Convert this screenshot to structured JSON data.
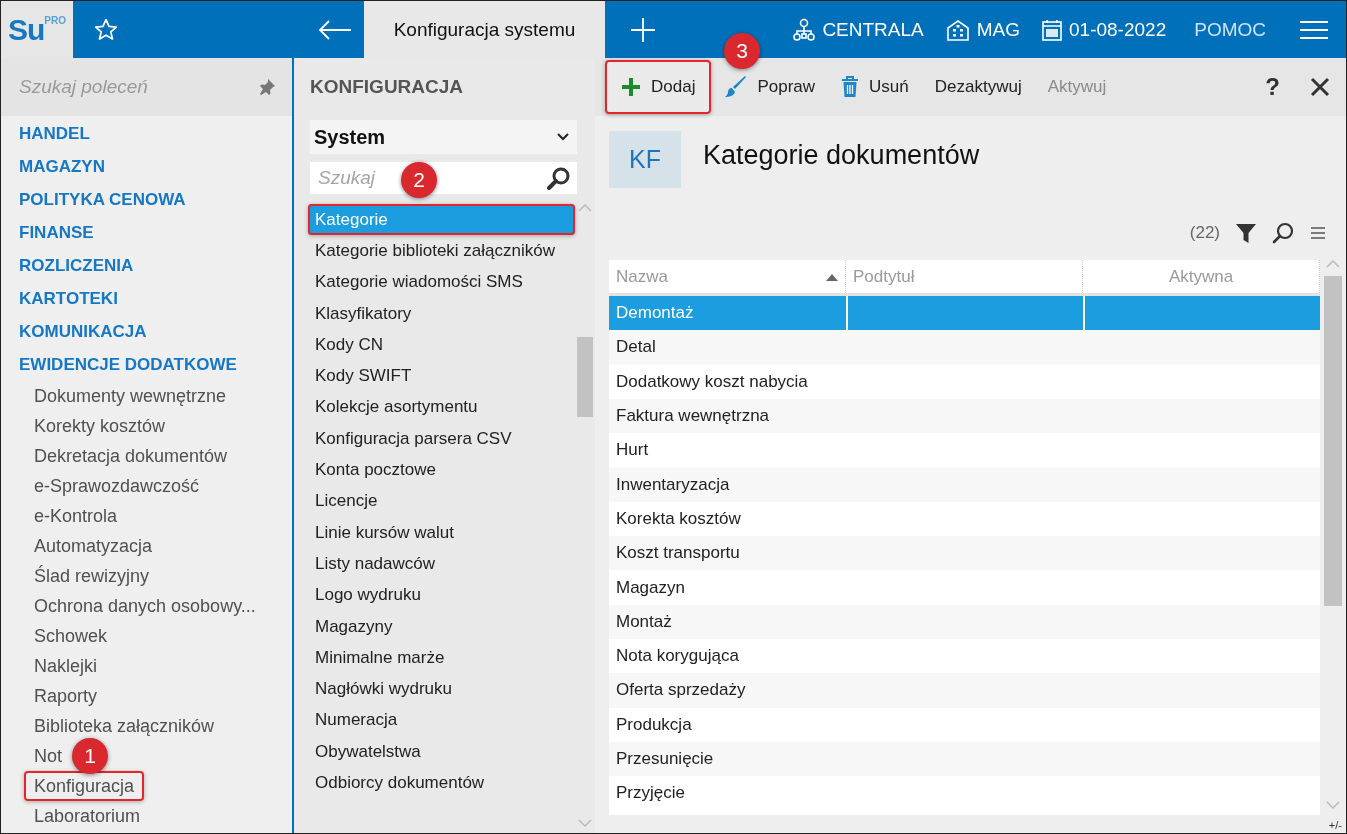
{
  "topbar": {
    "logo": "Su",
    "logo_sup": "PRO",
    "tab": "Konfiguracja systemu",
    "branch": "CENTRALA",
    "warehouse": "MAG",
    "date": "01-08-2022",
    "help": "POMOC"
  },
  "sidebar": {
    "search_placeholder": "Szukaj poleceń",
    "sections": [
      {
        "label": "HANDEL"
      },
      {
        "label": "MAGAZYN"
      },
      {
        "label": "POLITYKA CENOWA"
      },
      {
        "label": "FINANSE"
      },
      {
        "label": "ROZLICZENIA"
      },
      {
        "label": "KARTOTEKI"
      },
      {
        "label": "KOMUNIKACJA"
      },
      {
        "label": "EWIDENCJE DODATKOWE",
        "children": [
          {
            "label": "Dokumenty wewnętrzne"
          },
          {
            "label": "Korekty kosztów"
          },
          {
            "label": "Dekretacja dokumentów"
          },
          {
            "label": "e-Sprawozdawczość"
          },
          {
            "label": "e-Kontrola"
          },
          {
            "label": "Automatyzacja"
          },
          {
            "label": "Ślad rewizyjny"
          },
          {
            "label": "Ochrona danych osobowy..."
          },
          {
            "label": "Schowek"
          },
          {
            "label": "Naklejki"
          },
          {
            "label": "Raporty"
          },
          {
            "label": "Biblioteka załączników"
          },
          {
            "label": "Not"
          },
          {
            "label": "Konfiguracja",
            "callout": "1"
          },
          {
            "label": "Laboratorium"
          }
        ]
      }
    ]
  },
  "config": {
    "title": "KONFIGURACJA",
    "dropdown": "System",
    "search_placeholder": "Szukaj",
    "items": [
      {
        "label": "Kategorie",
        "selected": true,
        "callout": "2"
      },
      {
        "label": "Kategorie biblioteki załączników",
        "selected": false
      },
      {
        "label": "Kategorie wiadomości SMS",
        "selected": false
      },
      {
        "label": "Klasyfikatory",
        "selected": false
      },
      {
        "label": "Kody CN",
        "selected": false
      },
      {
        "label": "Kody SWIFT",
        "selected": false
      },
      {
        "label": "Kolekcje asortymentu",
        "selected": false
      },
      {
        "label": "Konfiguracja parsera CSV",
        "selected": false
      },
      {
        "label": "Konta pocztowe",
        "selected": false
      },
      {
        "label": "Licencje",
        "selected": false
      },
      {
        "label": "Linie kursów walut",
        "selected": false
      },
      {
        "label": "Listy nadawców",
        "selected": false
      },
      {
        "label": "Logo wydruku",
        "selected": false
      },
      {
        "label": "Magazyny",
        "selected": false
      },
      {
        "label": "Minimalne marże",
        "selected": false
      },
      {
        "label": "Nagłówki wydruku",
        "selected": false
      },
      {
        "label": "Numeracja",
        "selected": false
      },
      {
        "label": "Obywatelstwa",
        "selected": false
      },
      {
        "label": "Odbiorcy dokumentów",
        "selected": false
      }
    ]
  },
  "toolbar": {
    "actions": [
      {
        "label": "Dodaj",
        "kind": "add",
        "disabled": false,
        "callout": "3"
      },
      {
        "label": "Popraw",
        "kind": "edit",
        "disabled": false
      },
      {
        "label": "Usuń",
        "kind": "delete",
        "disabled": false
      },
      {
        "label": "Dezaktywuj",
        "kind": "text",
        "disabled": false
      },
      {
        "label": "Aktywuj",
        "kind": "text",
        "disabled": true
      }
    ],
    "help": "?"
  },
  "header": {
    "badge": "KF",
    "title": "Kategorie dokumentów"
  },
  "table": {
    "count": "(22)",
    "columns": [
      {
        "label": "Nazwa",
        "sorted": true
      },
      {
        "label": "Podtytuł"
      },
      {
        "label": "Aktywna"
      }
    ],
    "rows": [
      {
        "name": "Demontaż",
        "selected": true
      },
      {
        "name": "Detal",
        "selected": false
      },
      {
        "name": "Dodatkowy koszt nabycia",
        "selected": false
      },
      {
        "name": "Faktura wewnętrzna",
        "selected": false
      },
      {
        "name": "Hurt",
        "selected": false
      },
      {
        "name": "Inwentaryzacja",
        "selected": false
      },
      {
        "name": "Korekta kosztów",
        "selected": false
      },
      {
        "name": "Koszt transportu",
        "selected": false
      },
      {
        "name": "Magazyn",
        "selected": false
      },
      {
        "name": "Montaż",
        "selected": false
      },
      {
        "name": "Nota korygująca",
        "selected": false
      },
      {
        "name": "Oferta sprzedaży",
        "selected": false
      },
      {
        "name": "Produkcja",
        "selected": false
      },
      {
        "name": "Przesunięcie",
        "selected": false
      },
      {
        "name": "Przyjęcie",
        "selected": false
      }
    ],
    "footer": "+/-"
  }
}
